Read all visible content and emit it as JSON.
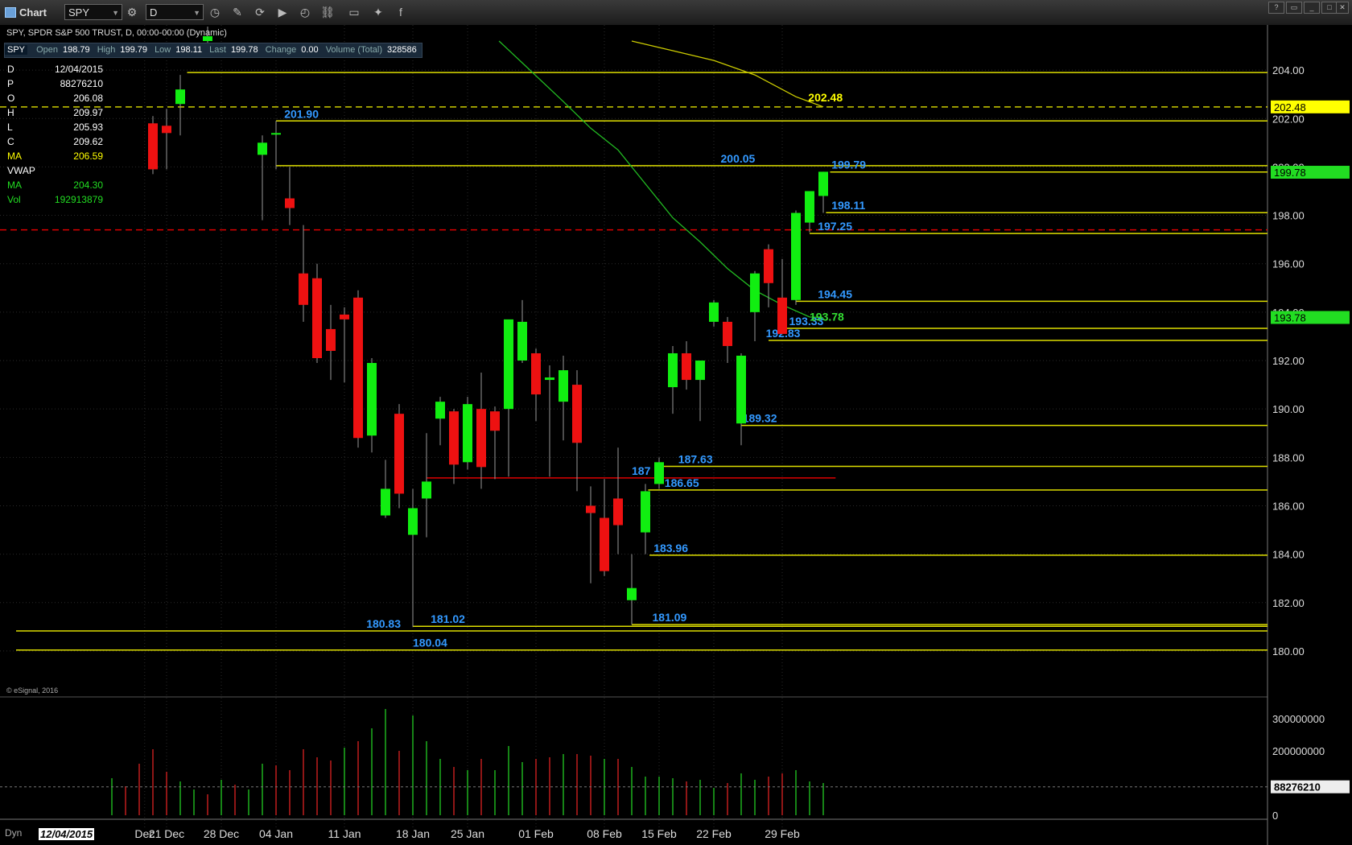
{
  "window": {
    "title": "Chart",
    "symbol": "SPY",
    "interval": "D"
  },
  "header": {
    "description": "SPY, SPDR S&P 500 TRUST, D, 00:00-00:00 (Dynamic)"
  },
  "infobar": {
    "symbol": "SPY",
    "open_label": "Open",
    "open": "198.79",
    "high_label": "High",
    "high": "199.79",
    "low_label": "Low",
    "low": "198.11",
    "last_label": "Last",
    "last": "199.78",
    "change_label": "Change",
    "change": "0.00",
    "volume_label": "Volume (Total)",
    "volume": "328586"
  },
  "data_window": [
    {
      "key": "D",
      "value": "12/04/2015",
      "color": "#ffffff"
    },
    {
      "key": "P",
      "value": "88276210",
      "color": "#ffffff"
    },
    {
      "key": "O",
      "value": "206.08",
      "color": "#ffffff"
    },
    {
      "key": "H",
      "value": "209.97",
      "color": "#ffffff"
    },
    {
      "key": "L",
      "value": "205.93",
      "color": "#ffffff"
    },
    {
      "key": "C",
      "value": "209.62",
      "color": "#ffffff"
    },
    {
      "key": "MA",
      "value": "206.59",
      "color": "#ffff00"
    },
    {
      "key": "VWAP",
      "value": "",
      "color": "#ffffff"
    },
    {
      "key": "MA",
      "value": "204.30",
      "color": "#22dd22"
    },
    {
      "key": "Vol",
      "value": "192913879",
      "color": "#22dd22"
    }
  ],
  "footer": {
    "esignal": "© eSignal, 2016",
    "dyn": "Dyn",
    "current_date": "12/04/2015"
  },
  "chart_data": {
    "type": "candlestick",
    "ylim": [
      179,
      205.3
    ],
    "price_ticks": [
      180,
      182,
      184,
      186,
      188,
      190,
      192,
      194,
      196,
      198,
      200,
      202,
      204
    ],
    "x_labels": [
      {
        "label": "Dec",
        "index": -0.6
      },
      {
        "label": "21 Dec",
        "index": 1
      },
      {
        "label": "28 Dec",
        "index": 5
      },
      {
        "label": "04 Jan",
        "index": 9
      },
      {
        "label": "11 Jan",
        "index": 14
      },
      {
        "label": "18 Jan",
        "index": 19
      },
      {
        "label": "25 Jan",
        "index": 23
      },
      {
        "label": "01 Feb",
        "index": 28
      },
      {
        "label": "08 Feb",
        "index": 33
      },
      {
        "label": "15 Feb",
        "index": 37
      },
      {
        "label": "22 Feb",
        "index": 41
      },
      {
        "label": "29 Feb",
        "index": 46
      }
    ],
    "candles": [
      {
        "i": 0,
        "o": 201.8,
        "h": 202.1,
        "l": 199.7,
        "c": 199.9
      },
      {
        "i": 1,
        "o": 201.7,
        "h": 202.4,
        "l": 199.9,
        "c": 201.4
      },
      {
        "i": 2,
        "o": 202.6,
        "h": 203.8,
        "l": 201.3,
        "c": 203.2
      },
      {
        "i": 4,
        "o": 205.2,
        "h": 205.8,
        "l": 204.8,
        "c": 205.4
      },
      {
        "i": 8,
        "o": 200.5,
        "h": 201.3,
        "l": 197.8,
        "c": 201.0
      },
      {
        "i": 9,
        "o": 201.4,
        "h": 201.9,
        "l": 199.9,
        "c": 201.4
      },
      {
        "i": 10,
        "o": 198.7,
        "h": 200.0,
        "l": 197.6,
        "c": 198.3
      },
      {
        "i": 11,
        "o": 195.6,
        "h": 197.6,
        "l": 193.6,
        "c": 194.3
      },
      {
        "i": 12,
        "o": 195.4,
        "h": 196.0,
        "l": 191.9,
        "c": 192.1
      },
      {
        "i": 13,
        "o": 193.3,
        "h": 194.3,
        "l": 191.2,
        "c": 192.4
      },
      {
        "i": 14,
        "o": 193.9,
        "h": 194.2,
        "l": 191.1,
        "c": 193.7
      },
      {
        "i": 15,
        "o": 194.6,
        "h": 194.9,
        "l": 188.4,
        "c": 188.8
      },
      {
        "i": 16,
        "o": 188.9,
        "h": 192.1,
        "l": 188.2,
        "c": 191.9
      },
      {
        "i": 17,
        "o": 185.6,
        "h": 187.9,
        "l": 185.5,
        "c": 186.7
      },
      {
        "i": 18,
        "o": 189.8,
        "h": 190.2,
        "l": 185.9,
        "c": 186.5
      },
      {
        "i": 19,
        "o": 184.8,
        "h": 186.7,
        "l": 181.0,
        "c": 185.9
      },
      {
        "i": 20,
        "o": 186.3,
        "h": 189.0,
        "l": 184.7,
        "c": 187.0
      },
      {
        "i": 21,
        "o": 189.6,
        "h": 190.5,
        "l": 188.5,
        "c": 190.3
      },
      {
        "i": 22,
        "o": 189.9,
        "h": 190.0,
        "l": 186.9,
        "c": 187.7
      },
      {
        "i": 23,
        "o": 187.8,
        "h": 190.5,
        "l": 187.5,
        "c": 190.2
      },
      {
        "i": 24,
        "o": 190.0,
        "h": 191.5,
        "l": 186.7,
        "c": 187.6
      },
      {
        "i": 25,
        "o": 189.9,
        "h": 190.1,
        "l": 187.1,
        "c": 189.1
      },
      {
        "i": 26,
        "o": 190.0,
        "h": 193.5,
        "l": 187.2,
        "c": 193.7
      },
      {
        "i": 27,
        "o": 192.0,
        "h": 194.5,
        "l": 191.9,
        "c": 193.6
      },
      {
        "i": 28,
        "o": 192.3,
        "h": 192.5,
        "l": 189.5,
        "c": 190.6
      },
      {
        "i": 29,
        "o": 191.2,
        "h": 191.8,
        "l": 187.2,
        "c": 191.3
      },
      {
        "i": 30,
        "o": 190.3,
        "h": 192.2,
        "l": 188.7,
        "c": 191.6
      },
      {
        "i": 31,
        "o": 191.0,
        "h": 191.6,
        "l": 186.6,
        "c": 188.6
      },
      {
        "i": 32,
        "o": 186.0,
        "h": 186.8,
        "l": 182.8,
        "c": 185.7
      },
      {
        "i": 33,
        "o": 185.5,
        "h": 187.1,
        "l": 183.1,
        "c": 183.3
      },
      {
        "i": 34,
        "o": 186.3,
        "h": 188.4,
        "l": 184.0,
        "c": 185.2
      },
      {
        "i": 35,
        "o": 182.1,
        "h": 184.0,
        "l": 181.1,
        "c": 182.6
      },
      {
        "i": 36,
        "o": 184.9,
        "h": 186.9,
        "l": 184.0,
        "c": 186.6
      },
      {
        "i": 37,
        "o": 186.9,
        "h": 188.0,
        "l": 186.7,
        "c": 187.8
      },
      {
        "i": 38,
        "o": 190.9,
        "h": 192.6,
        "l": 189.8,
        "c": 192.3
      },
      {
        "i": 39,
        "o": 192.3,
        "h": 192.8,
        "l": 190.8,
        "c": 191.2
      },
      {
        "i": 40,
        "o": 191.2,
        "h": 192.0,
        "l": 189.5,
        "c": 192.0
      },
      {
        "i": 41,
        "o": 193.6,
        "h": 194.5,
        "l": 193.4,
        "c": 194.4
      },
      {
        "i": 42,
        "o": 193.6,
        "h": 193.8,
        "l": 191.9,
        "c": 192.6
      },
      {
        "i": 43,
        "o": 189.4,
        "h": 192.3,
        "l": 188.5,
        "c": 192.2
      },
      {
        "i": 44,
        "o": 194.0,
        "h": 195.7,
        "l": 192.8,
        "c": 195.6
      },
      {
        "i": 45,
        "o": 196.6,
        "h": 196.8,
        "l": 194.2,
        "c": 195.2
      },
      {
        "i": 46,
        "o": 194.6,
        "h": 196.2,
        "l": 193.3,
        "c": 193.1
      },
      {
        "i": 47,
        "o": 194.5,
        "h": 198.2,
        "l": 194.3,
        "c": 198.1
      },
      {
        "i": 48,
        "o": 197.7,
        "h": 199.0,
        "l": 197.3,
        "c": 199.0
      },
      {
        "i": 49,
        "o": 198.8,
        "h": 199.8,
        "l": 198.1,
        "c": 199.8
      }
    ],
    "moving_averages": [
      {
        "name": "MA",
        "color": "#cccc00",
        "points": [
          [
            35.0,
            205.2
          ],
          [
            38.0,
            204.8
          ],
          [
            41.0,
            204.4
          ],
          [
            44.0,
            203.8
          ],
          [
            47.0,
            202.9
          ],
          [
            49.0,
            202.48
          ]
        ]
      },
      {
        "name": "MA",
        "color": "#22bb22",
        "points": [
          [
            25.3,
            205.2
          ],
          [
            27.0,
            204.3
          ],
          [
            30.0,
            202.7
          ],
          [
            32.0,
            201.6
          ],
          [
            34.0,
            200.7
          ],
          [
            36.0,
            199.3
          ],
          [
            38.0,
            197.9
          ],
          [
            40.0,
            196.9
          ],
          [
            42.0,
            195.8
          ],
          [
            44.0,
            194.9
          ],
          [
            46.0,
            194.3
          ],
          [
            48.0,
            193.8
          ],
          [
            49.0,
            193.78
          ]
        ]
      }
    ],
    "horizontal_levels": [
      {
        "value": 203.9,
        "color": "#dddd00",
        "from": 2.5,
        "label": ""
      },
      {
        "value": 201.9,
        "color": "#dddd00",
        "from": 9,
        "label": "201.90",
        "label_at": 9.6,
        "label_color": "#3399ff"
      },
      {
        "value": 200.05,
        "color": "#dddd00",
        "from": 9,
        "label": "200.05",
        "label_at": 41.5,
        "label_color": "#3399ff"
      },
      {
        "value": 199.79,
        "color": "#dddd00",
        "from": 49.5,
        "label": "199.79",
        "label_at": 49.6,
        "label_color": "#3399ff"
      },
      {
        "value": 198.11,
        "color": "#dddd00",
        "from": 49.2,
        "label": "198.11",
        "label_at": 49.6,
        "label_color": "#3399ff"
      },
      {
        "value": 197.25,
        "color": "#dddd00",
        "from": 48.0,
        "label": "197.25",
        "label_at": 48.6,
        "label_color": "#3399ff"
      },
      {
        "value": 194.45,
        "color": "#dddd00",
        "from": 47.0,
        "label": "194.45",
        "label_at": 48.6,
        "label_color": "#3399ff"
      },
      {
        "value": 193.33,
        "color": "#dddd00",
        "from": 46.0,
        "label": "193.33",
        "label_at": 46.5,
        "label_color": "#3399ff"
      },
      {
        "value": 192.83,
        "color": "#dddd00",
        "from": 45.0,
        "label": "192.83",
        "label_at": 44.8,
        "label_color": "#3399ff"
      },
      {
        "value": 189.32,
        "color": "#dddd00",
        "from": 43.0,
        "label": "189.32",
        "label_at": 43.1,
        "label_color": "#3399ff"
      },
      {
        "value": 187.63,
        "color": "#dddd00",
        "from": 37.0,
        "label": "187.63",
        "label_at": 38.4,
        "label_color": "#3399ff"
      },
      {
        "value": 186.65,
        "color": "#dddd00",
        "from": 36.2,
        "label": "186.65",
        "label_at": 37.4,
        "label_color": "#3399ff"
      },
      {
        "value": 183.96,
        "color": "#dddd00",
        "from": 36.3,
        "label": "183.96",
        "label_at": 36.6,
        "label_color": "#3399ff"
      },
      {
        "value": 181.02,
        "color": "#dddd00",
        "from": 19.0,
        "label": "181.02",
        "label_at": 20.3,
        "label_color": "#3399ff"
      },
      {
        "value": 181.09,
        "color": "#dddd00",
        "from": 35.0,
        "label": "181.09",
        "label_at": 36.5,
        "label_color": "#3399ff"
      },
      {
        "value": 180.83,
        "color": "#dddd00",
        "from": -10,
        "label": "180.83",
        "label_at": 15.6,
        "label_color": "#3399ff"
      },
      {
        "value": 180.04,
        "color": "#dddd00",
        "from": -10,
        "label": "180.04",
        "label_at": 19.0,
        "label_color": "#3399ff"
      },
      {
        "value": 187.15,
        "color": "#dd0000",
        "from": 20.0,
        "to": 49.9,
        "label": "187",
        "label_at": 35.0,
        "label_color": "#3399ff"
      }
    ],
    "dashed_levels": [
      {
        "value": 202.48,
        "color": "#cccc00",
        "label": "202.48"
      },
      {
        "value": 197.4,
        "color": "#dd0000",
        "label": ""
      }
    ],
    "ma_labels": [
      {
        "text": "202.48",
        "i": 47.9,
        "value": 202.7,
        "color": "#ffff00"
      },
      {
        "text": "193.78",
        "i": 48.0,
        "value": 193.65,
        "color": "#33dd33"
      }
    ],
    "price_flags": [
      {
        "value": 202.48,
        "text": "202.48",
        "bg": "#ffff00",
        "fg": "#000000"
      },
      {
        "value": 199.78,
        "text": "199.78",
        "bg": "#22dd22",
        "fg": "#000000"
      },
      {
        "value": 193.78,
        "text": "193.78",
        "bg": "#22dd22",
        "fg": "#000000"
      }
    ],
    "volume": {
      "ticks": [
        {
          "value": 300000000,
          "label": "300000000"
        },
        {
          "value": 200000000,
          "label": "200000000"
        },
        {
          "value": 0,
          "label": "0"
        }
      ],
      "flag": {
        "value": 88276210,
        "text": "88276210"
      },
      "max": 330000000,
      "bars": [
        {
          "i": -3,
          "v": 115000000,
          "c": "g"
        },
        {
          "i": -2,
          "v": 90000000,
          "c": "r"
        },
        {
          "i": -1,
          "v": 160000000,
          "c": "r"
        },
        {
          "i": 0,
          "v": 205000000,
          "c": "r"
        },
        {
          "i": 1,
          "v": 135000000,
          "c": "r"
        },
        {
          "i": 2,
          "v": 105000000,
          "c": "g"
        },
        {
          "i": 3,
          "v": 80000000,
          "c": "g"
        },
        {
          "i": 4,
          "v": 65000000,
          "c": "r"
        },
        {
          "i": 5,
          "v": 110000000,
          "c": "g"
        },
        {
          "i": 6,
          "v": 95000000,
          "c": "r"
        },
        {
          "i": 7,
          "v": 80000000,
          "c": "g"
        },
        {
          "i": 8,
          "v": 160000000,
          "c": "g"
        },
        {
          "i": 9,
          "v": 155000000,
          "c": "r"
        },
        {
          "i": 10,
          "v": 140000000,
          "c": "r"
        },
        {
          "i": 11,
          "v": 205000000,
          "c": "r"
        },
        {
          "i": 12,
          "v": 180000000,
          "c": "r"
        },
        {
          "i": 13,
          "v": 170000000,
          "c": "r"
        },
        {
          "i": 14,
          "v": 210000000,
          "c": "g"
        },
        {
          "i": 15,
          "v": 230000000,
          "c": "r"
        },
        {
          "i": 16,
          "v": 270000000,
          "c": "g"
        },
        {
          "i": 17,
          "v": 330000000,
          "c": "g"
        },
        {
          "i": 18,
          "v": 200000000,
          "c": "r"
        },
        {
          "i": 19,
          "v": 310000000,
          "c": "g"
        },
        {
          "i": 20,
          "v": 230000000,
          "c": "g"
        },
        {
          "i": 21,
          "v": 175000000,
          "c": "g"
        },
        {
          "i": 22,
          "v": 150000000,
          "c": "r"
        },
        {
          "i": 23,
          "v": 140000000,
          "c": "g"
        },
        {
          "i": 24,
          "v": 175000000,
          "c": "r"
        },
        {
          "i": 25,
          "v": 140000000,
          "c": "g"
        },
        {
          "i": 26,
          "v": 215000000,
          "c": "g"
        },
        {
          "i": 27,
          "v": 165000000,
          "c": "g"
        },
        {
          "i": 28,
          "v": 175000000,
          "c": "r"
        },
        {
          "i": 29,
          "v": 180000000,
          "c": "r"
        },
        {
          "i": 30,
          "v": 190000000,
          "c": "g"
        },
        {
          "i": 31,
          "v": 190000000,
          "c": "r"
        },
        {
          "i": 32,
          "v": 185000000,
          "c": "r"
        },
        {
          "i": 33,
          "v": 175000000,
          "c": "g"
        },
        {
          "i": 34,
          "v": 175000000,
          "c": "r"
        },
        {
          "i": 35,
          "v": 150000000,
          "c": "g"
        },
        {
          "i": 36,
          "v": 120000000,
          "c": "g"
        },
        {
          "i": 37,
          "v": 120000000,
          "c": "g"
        },
        {
          "i": 38,
          "v": 115000000,
          "c": "g"
        },
        {
          "i": 39,
          "v": 105000000,
          "c": "r"
        },
        {
          "i": 40,
          "v": 110000000,
          "c": "g"
        },
        {
          "i": 41,
          "v": 85000000,
          "c": "g"
        },
        {
          "i": 42,
          "v": 100000000,
          "c": "r"
        },
        {
          "i": 43,
          "v": 130000000,
          "c": "g"
        },
        {
          "i": 44,
          "v": 110000000,
          "c": "g"
        },
        {
          "i": 45,
          "v": 120000000,
          "c": "r"
        },
        {
          "i": 46,
          "v": 130000000,
          "c": "r"
        },
        {
          "i": 47,
          "v": 140000000,
          "c": "g"
        },
        {
          "i": 48,
          "v": 105000000,
          "c": "g"
        },
        {
          "i": 49,
          "v": 100000000,
          "c": "g"
        }
      ]
    }
  }
}
